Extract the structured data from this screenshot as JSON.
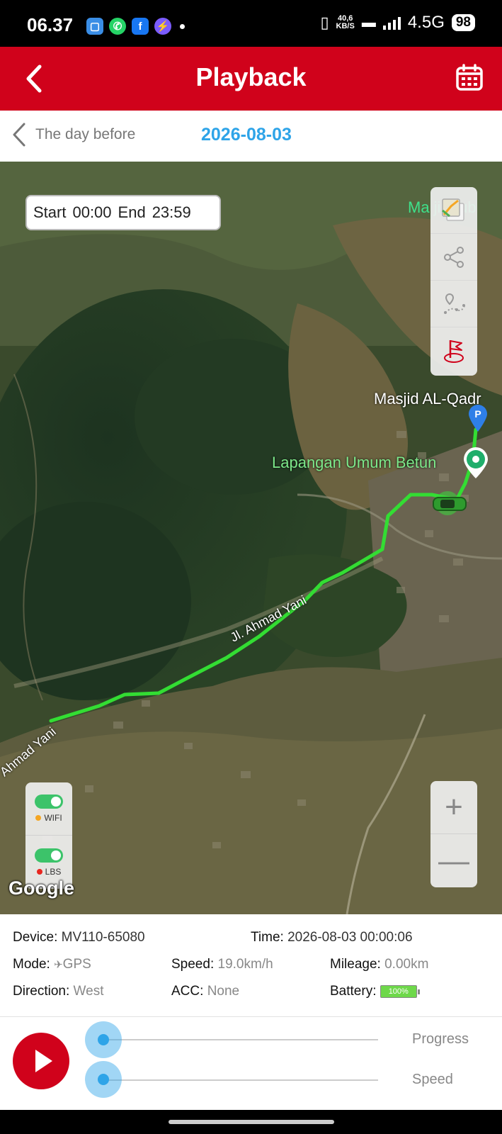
{
  "status_bar": {
    "time": "06.37",
    "net_speed_value": "40,6",
    "net_speed_unit": "KB/S",
    "network": "4.5G",
    "battery": "98"
  },
  "header": {
    "title": "Playback"
  },
  "date_nav": {
    "prev_label": "The day before",
    "date": "2026-08-03"
  },
  "map": {
    "time_range": {
      "start_label": "Start",
      "start_value": "00:00",
      "end_label": "End",
      "end_value": "23:59"
    },
    "labels": {
      "poi_top": "Ma    jir Tub",
      "masjid": "Masjid AL-Qadr",
      "lapangan": "Lapangan Umum Betun",
      "road_1": "Jl. Ahmad Yani",
      "road_2": "Ahmad Yani",
      "attribution": "Google",
      "parking": "P"
    },
    "toggles": {
      "wifi_label": "WIFI",
      "lbs_label": "LBS",
      "wifi_on": true,
      "lbs_on": true
    },
    "zoom": {
      "in": "+",
      "out": "—"
    },
    "colors": {
      "track": "#33dd33",
      "wifi_dot": "#f5a623",
      "lbs_dot": "#e8261f"
    }
  },
  "info": {
    "device_label": "Device:",
    "device_value": "MV110-65080",
    "time_label": "Time:",
    "time_value": "2026-08-03 00:00:06",
    "mode_label": "Mode:",
    "mode_value": "GPS",
    "speed_label": "Speed:",
    "speed_value": "19.0km/h",
    "mileage_label": "Mileage:",
    "mileage_value": "0.00km",
    "direction_label": "Direction:",
    "direction_value": "West",
    "acc_label": "ACC:",
    "acc_value": "None",
    "battery_label": "Battery:",
    "battery_value": "100%"
  },
  "controls": {
    "progress_label": "Progress",
    "speed_label": "Speed",
    "progress_value": 0,
    "speed_value": 0
  },
  "theme": {
    "primary": "#d0021b",
    "accent": "#2ea4e8"
  }
}
